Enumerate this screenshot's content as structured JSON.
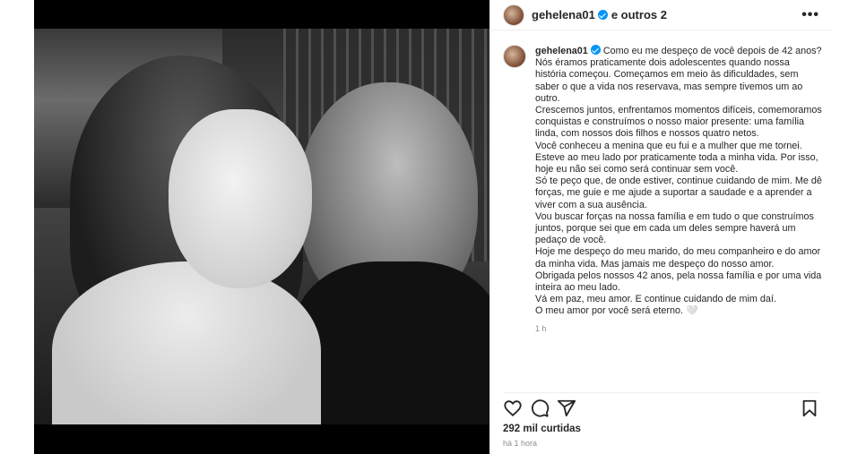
{
  "header": {
    "username": "gehelena01",
    "others": "e outros 2",
    "more_label": "•••"
  },
  "caption": {
    "username": "gehelena01",
    "lines": [
      "Como eu me despeço de você depois de 42 anos?",
      "Nós éramos praticamente dois adolescentes quando nossa história começou. Começamos em meio às dificuldades, sem saber o que a vida nos reservava, mas sempre tivemos um ao outro.",
      "Crescemos juntos, enfrentamos momentos difíceis, comemoramos conquistas e construímos o nosso maior presente: uma família linda, com nossos dois filhos e nossos quatro netos.",
      "Você conheceu a menina que eu fui e a mulher que me tornei. Esteve ao meu lado por praticamente toda a minha vida. Por isso, hoje eu não sei como será continuar sem você.",
      "Só te peço que, de onde estiver, continue cuidando de mim. Me dê forças, me guie e me ajude a suportar a saudade e a aprender a viver com a sua ausência.",
      "Vou buscar forças na nossa família e em tudo o que construímos juntos, porque sei que em cada um deles sempre haverá um pedaço de você.",
      "Hoje me despeço do meu marido, do meu companheiro e do amor da minha vida. Mas jamais me despeço do nosso amor.",
      "Obrigada pelos nossos 42 anos, pela nossa família e por uma vida inteira ao meu lado.",
      "Vá em paz, meu amor. E continue cuidando de mim daí.",
      "O meu amor por você será eterno. 🤍"
    ],
    "time": "1 h"
  },
  "stats": {
    "likes": "292 mil curtidas",
    "posted": "há 1 hora"
  },
  "icons": {
    "like": "heart-icon",
    "comment": "comment-icon",
    "share": "share-icon",
    "save": "bookmark-icon",
    "tagged": "user-icon",
    "verified": "verified-badge-icon"
  },
  "colors": {
    "verified": "#0095f6",
    "text": "#262626",
    "muted": "#8e8e8e"
  }
}
